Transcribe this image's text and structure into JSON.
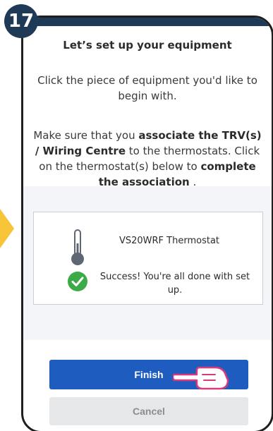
{
  "step_number": "17",
  "header": {
    "title": "Let’s set up your equipment"
  },
  "instructions": {
    "intro": "Click the piece of equipment you'd like to begin with.",
    "association": {
      "part1": "Make sure that you ",
      "bold1": "associate the TRV(s) / Wiring Centre",
      "part2": " to the thermostats. Click on the thermostat(s) below to ",
      "bold2": "complete the association",
      "part3": " ."
    }
  },
  "device": {
    "name": "VS20WRF Thermostat",
    "status": "Success! You're all done with set up.",
    "icon": "thermometer-icon",
    "status_icon": "check-circle-icon"
  },
  "actions": {
    "finish_label": "Finish",
    "cancel_label": "Cancel"
  },
  "colors": {
    "primary": "#1e5cbf",
    "header": "#1f3a57",
    "success": "#3daa4a",
    "accent": "#f7c437",
    "cancel_bg": "#e6e7e9"
  }
}
